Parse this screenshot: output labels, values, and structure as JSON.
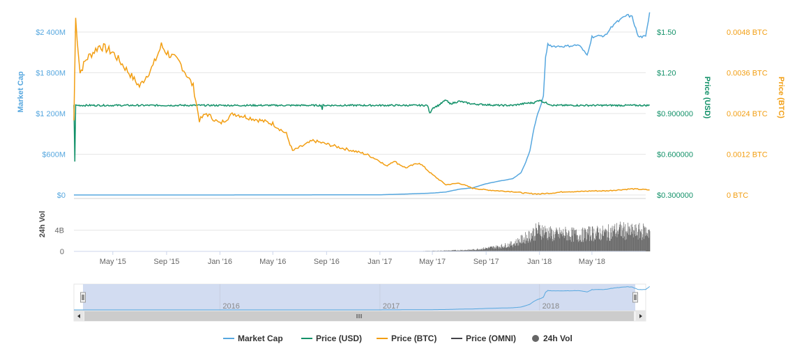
{
  "colors": {
    "market_cap": "#56a7df",
    "price_usd": "#139169",
    "price_btc": "#f29e12",
    "price_omni": "#434348",
    "volume": "#666666",
    "grid": "#e6e6e6",
    "navigator_fill": "#cad6ee"
  },
  "icons": {
    "navigator_left_handle": "double-bar-icon",
    "navigator_right_handle": "double-bar-icon",
    "scroll_left": "triangle-left-icon",
    "scroll_right": "triangle-right-icon",
    "scroll_grip": "triple-bar-icon",
    "legend_volume": "filled-circle-icon"
  },
  "chart_data": {
    "type": "line",
    "x_ticks": [
      "May '15",
      "Sep '15",
      "Jan '16",
      "May '16",
      "Sep '16",
      "Jan '17",
      "May '17",
      "Sep '17",
      "Jan '18",
      "May '18"
    ],
    "x_range": [
      "2015-02",
      "2018-09"
    ],
    "axes": {
      "market_cap": {
        "label": "Market Cap",
        "ticks": [
          "$0",
          "$600M",
          "$1 200M",
          "$1 800M",
          "$2 400M"
        ],
        "range": [
          0,
          2400
        ]
      },
      "price_usd": {
        "label": "Price (USD)",
        "ticks": [
          "$0.300000",
          "$0.600000",
          "$0.900000",
          "$1.20",
          "$1.50"
        ],
        "range": [
          0.3,
          1.5
        ]
      },
      "price_btc": {
        "label": "Price (BTC)",
        "ticks": [
          "0 BTC",
          "0.0012 BTC",
          "0.0024 BTC",
          "0.0036 BTC",
          "0.0048 BTC"
        ],
        "range": [
          0,
          0.0048
        ]
      },
      "volume": {
        "label": "24h Vol",
        "ticks": [
          "0",
          "4B"
        ],
        "range": [
          0,
          8
        ]
      }
    },
    "legend": [
      "Market Cap",
      "Price (USD)",
      "Price (BTC)",
      "Price (OMNI)",
      "24h Vol"
    ],
    "navigator_ticks": [
      "2016",
      "2017",
      "2018"
    ],
    "series": [
      {
        "name": "Market Cap",
        "unit": "$M",
        "points": [
          [
            "2015-02",
            0
          ],
          [
            "2015-10",
            0
          ],
          [
            "2016-06",
            1
          ],
          [
            "2017-01",
            3
          ],
          [
            "2017-03",
            14
          ],
          [
            "2017-05",
            28
          ],
          [
            "2017-06",
            44
          ],
          [
            "2017-07",
            85
          ],
          [
            "2017-08",
            105
          ],
          [
            "2017-09",
            165
          ],
          [
            "2017-10",
            205
          ],
          [
            "2017-11",
            240
          ],
          [
            "2017-11-20",
            330
          ],
          [
            "2017-12-01",
            490
          ],
          [
            "2017-12-10",
            650
          ],
          [
            "2017-12-20",
            1000
          ],
          [
            "2017-12-28",
            1200
          ],
          [
            "2018-01-05",
            1330
          ],
          [
            "2018-01-10",
            1470
          ],
          [
            "2018-01-15",
            2020
          ],
          [
            "2018-01-20",
            2220
          ],
          [
            "2018-02",
            2190
          ],
          [
            "2018-03",
            2190
          ],
          [
            "2018-04",
            2210
          ],
          [
            "2018-04-20",
            2060
          ],
          [
            "2018-05",
            2330
          ],
          [
            "2018-06",
            2350
          ],
          [
            "2018-06-20",
            2520
          ],
          [
            "2018-07",
            2560
          ],
          [
            "2018-07-20",
            2650
          ],
          [
            "2018-08",
            2620
          ],
          [
            "2018-08-15",
            2330
          ],
          [
            "2018-09",
            2330
          ],
          [
            "2018-09-10",
            2690
          ]
        ]
      },
      {
        "name": "Price (USD)",
        "unit": "USD",
        "points": [
          [
            "2015-02",
            0.96
          ],
          [
            "2015-02-03",
            0.55
          ],
          [
            "2015-02-05",
            0.96
          ],
          [
            "2015-06",
            0.96
          ],
          [
            "2016-01",
            0.96
          ],
          [
            "2016-08-20",
            0.96
          ],
          [
            "2016-08-22",
            0.93
          ],
          [
            "2016-08-24",
            0.96
          ],
          [
            "2017-01",
            0.96
          ],
          [
            "2017-04",
            0.96
          ],
          [
            "2017-04-20",
            0.96
          ],
          [
            "2017-04-25",
            0.9
          ],
          [
            "2017-05",
            0.94
          ],
          [
            "2017-05-15",
            0.96
          ],
          [
            "2017-06",
            1.0
          ],
          [
            "2017-06-10",
            0.97
          ],
          [
            "2017-07",
            0.99
          ],
          [
            "2017-08",
            0.97
          ],
          [
            "2017-09",
            0.965
          ],
          [
            "2017-10",
            0.96
          ],
          [
            "2017-11",
            0.96
          ],
          [
            "2017-12",
            0.975
          ],
          [
            "2017-12-20",
            0.98
          ],
          [
            "2018-01",
            1.0
          ],
          [
            "2018-01-10",
            0.985
          ],
          [
            "2018-02",
            0.96
          ],
          [
            "2018-04",
            0.96
          ],
          [
            "2018-06",
            0.96
          ],
          [
            "2018-09-10",
            0.96
          ]
        ]
      },
      {
        "name": "Price (BTC)",
        "unit": "BTC",
        "points": [
          [
            "2015-02",
            0.0022
          ],
          [
            "2015-02-05",
            0.0052
          ],
          [
            "2015-02-15",
            0.0036
          ],
          [
            "2015-03",
            0.004
          ],
          [
            "2015-04",
            0.0044
          ],
          [
            "2015-05",
            0.0042
          ],
          [
            "2015-06",
            0.0037
          ],
          [
            "2015-07",
            0.0032
          ],
          [
            "2015-08",
            0.0038
          ],
          [
            "2015-08-20",
            0.0044
          ],
          [
            "2015-09",
            0.0042
          ],
          [
            "2015-10",
            0.0039
          ],
          [
            "2015-11",
            0.0032
          ],
          [
            "2015-11-15",
            0.0022
          ],
          [
            "2015-12",
            0.0024
          ],
          [
            "2016-01",
            0.0021
          ],
          [
            "2016-02",
            0.0024
          ],
          [
            "2016-03",
            0.0023
          ],
          [
            "2016-04",
            0.0022
          ],
          [
            "2016-05",
            0.0021
          ],
          [
            "2016-06",
            0.0018
          ],
          [
            "2016-06-15",
            0.0013
          ],
          [
            "2016-07",
            0.0014
          ],
          [
            "2016-08",
            0.0016
          ],
          [
            "2016-09",
            0.0015
          ],
          [
            "2016-10",
            0.0014
          ],
          [
            "2016-11",
            0.0013
          ],
          [
            "2016-12",
            0.0012
          ],
          [
            "2017-01",
            0.001
          ],
          [
            "2017-01-15",
            0.00085
          ],
          [
            "2017-02",
            0.001
          ],
          [
            "2017-03",
            0.0008
          ],
          [
            "2017-04",
            0.00095
          ],
          [
            "2017-05",
            0.0006
          ],
          [
            "2017-06",
            0.0003
          ],
          [
            "2017-07",
            0.00035
          ],
          [
            "2017-08",
            0.0002
          ],
          [
            "2017-09",
            0.00015
          ],
          [
            "2017-10",
            0.00012
          ],
          [
            "2017-11",
            0.0001
          ],
          [
            "2017-12",
            5e-05
          ],
          [
            "2018-01",
            3e-05
          ],
          [
            "2018-02",
            6e-05
          ],
          [
            "2018-03",
            0.0001
          ],
          [
            "2018-04",
            0.0001
          ],
          [
            "2018-05",
            0.00012
          ],
          [
            "2018-06",
            0.00012
          ],
          [
            "2018-07",
            0.00015
          ],
          [
            "2018-08",
            0.00018
          ],
          [
            "2018-09-10",
            0.00015
          ]
        ]
      },
      {
        "name": "24h Vol",
        "unit": "B USD",
        "points": [
          [
            "2017-04",
            0.05
          ],
          [
            "2017-06",
            0.15
          ],
          [
            "2017-08",
            0.3
          ],
          [
            "2017-09",
            0.6
          ],
          [
            "2017-10",
            0.9
          ],
          [
            "2017-11",
            1.4
          ],
          [
            "2017-12",
            2.6
          ],
          [
            "2018-01",
            4.1
          ],
          [
            "2018-02",
            3.1
          ],
          [
            "2018-03",
            3.3
          ],
          [
            "2018-04",
            3.0
          ],
          [
            "2018-05",
            3.4
          ],
          [
            "2018-06",
            3.4
          ],
          [
            "2018-07",
            4.0
          ],
          [
            "2018-08",
            3.6
          ],
          [
            "2018-09-10",
            3.8
          ]
        ]
      }
    ]
  }
}
